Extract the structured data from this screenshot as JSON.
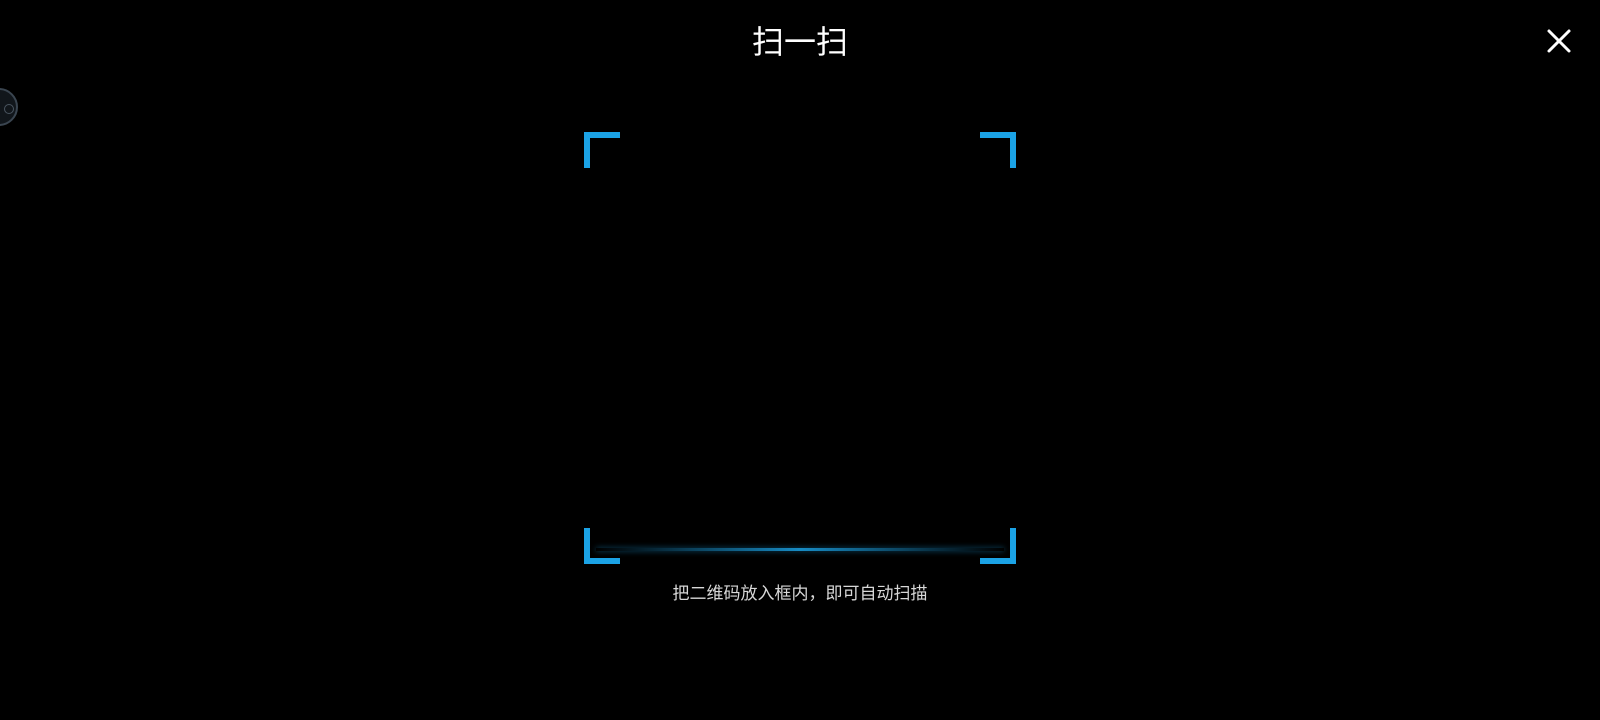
{
  "header": {
    "title": "扫一扫"
  },
  "actions": {
    "close_icon": "close-icon"
  },
  "scanner": {
    "hint": "把二维码放入框内，即可自动扫描",
    "accent_color": "#1ba3e6"
  },
  "colors": {
    "background": "#000000",
    "text": "#ffffff"
  }
}
